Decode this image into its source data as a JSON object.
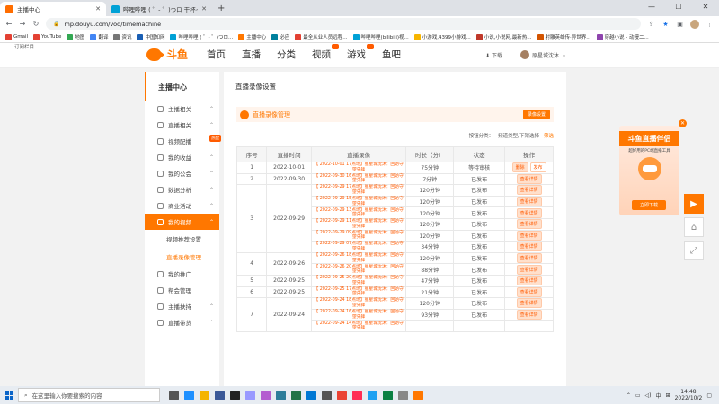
{
  "browser": {
    "tabs": [
      {
        "title": "主播中心",
        "active": true
      },
      {
        "title": "哔哩哔哩 ( ゜- ゜)つロ 干杯~-bili",
        "active": false
      }
    ],
    "new_tab": "+",
    "window_controls": [
      "—",
      "☐",
      "✕"
    ],
    "url": "mp.douyu.com/vod/timemachine",
    "bookmarks": [
      "Gmail",
      "YouTube",
      "地图",
      "翻译",
      "资讯",
      "中国知网",
      "哔哩哔哩 ( ゜- ゜)つロ...",
      "主播中心",
      "必应",
      "最全从业人员远程...",
      "哔哩哔哩(bilibili)视...",
      "小游戏,4399小游戏...",
      "小说,小说网,最新热...",
      "射雕英雄传·异世界...",
      "穿越小说 - 动漫二..."
    ]
  },
  "site": {
    "corner_text": "订阅栏目",
    "logo_text": "斗鱼",
    "nav": [
      "首页",
      "直播",
      "分类",
      "视频",
      "游戏",
      "鱼吧"
    ],
    "download_label": "下载",
    "username": "原星城沈沐"
  },
  "sidebar": {
    "title": "主播中心",
    "items": [
      {
        "label": "主播相关",
        "chevron": "⌃"
      },
      {
        "label": "直播相关",
        "chevron": "⌃"
      },
      {
        "label": "视频配播",
        "hot": "热配"
      },
      {
        "label": "我的收益",
        "chevron": "⌃"
      },
      {
        "label": "我的公会",
        "chevron": "⌃"
      },
      {
        "label": "数据分析",
        "chevron": "⌃"
      },
      {
        "label": "商业活动",
        "chevron": "⌃"
      },
      {
        "label": "我的视频",
        "chevron": "⌃",
        "active": true
      }
    ],
    "subitems": [
      "视频推荐设置",
      "直播录像管理"
    ],
    "bottom_items": [
      {
        "label": "我的推广"
      },
      {
        "label": "帮会管理"
      },
      {
        "label": "主播扶持",
        "chevron": "⌃"
      },
      {
        "label": "直播带货",
        "chevron": "⌃"
      }
    ]
  },
  "main": {
    "page_title": "直播录像设置",
    "section_title": "直播录像管理",
    "section_button": "录像设置",
    "filters": {
      "label": "按钮分类：",
      "value": "频道类型/下架选择",
      "link": "筛选"
    },
    "columns": [
      "序号",
      "直播时间",
      "直播录像",
      "时长（分）",
      "状态",
      "操作"
    ],
    "rows": [
      {
        "no": "1",
        "date": "2022-10-01",
        "span": 1,
        "videos": [
          {
            "title": "【 2022-10-01 17点场】星星城沈沐：回访守望先锋",
            "duration": "75分钟",
            "status": "等待审核",
            "action": "删除",
            "action2": "发布"
          }
        ]
      },
      {
        "no": "2",
        "date": "2022-09-30",
        "span": 1,
        "videos": [
          {
            "title": "【 2022-09-30 16点场】星星城沈沐：回访守望先锋",
            "duration": "7分钟",
            "status": "已发布",
            "action": "查看详情"
          }
        ]
      },
      {
        "no": "3",
        "date": "2022-09-29",
        "span": 6,
        "videos": [
          {
            "title": "【 2022-09-29 17点场】星星城沈沐：回访守望先锋",
            "duration": "120分钟",
            "status": "已发布",
            "action": "查看详情"
          },
          {
            "title": "【 2022-09-29 15点场】星星城沈沐：回访守望先锋",
            "duration": "120分钟",
            "status": "已发布",
            "action": "查看详情"
          },
          {
            "title": "【 2022-09-29 13点场】星星城沈沐：回访守望先锋",
            "duration": "120分钟",
            "status": "已发布",
            "action": "查看详情"
          },
          {
            "title": "【 2022-09-29 11点场】星星城沈沐：回访守望先锋",
            "duration": "120分钟",
            "status": "已发布",
            "action": "查看详情"
          },
          {
            "title": "【 2022-09-29 09点场】星星城沈沐：回访守望先锋",
            "duration": "120分钟",
            "status": "已发布",
            "action": "查看详情"
          },
          {
            "title": "【 2022-09-29 07点场】星星城沈沐：回访守望先锋",
            "duration": "34分钟",
            "status": "已发布",
            "action": "查看详情"
          }
        ]
      },
      {
        "no": "4",
        "date": "2022-09-26",
        "span": 2,
        "videos": [
          {
            "title": "【 2022-09-26 18点场】星星城沈沐：回访守望先锋",
            "duration": "120分钟",
            "status": "已发布",
            "action": "查看详情"
          },
          {
            "title": "【 2022-09-26 20点场】星星城沈沐：回访守望先锋",
            "duration": "88分钟",
            "status": "已发布",
            "action": "查看详情"
          }
        ]
      },
      {
        "no": "5",
        "date": "2022-09-25",
        "span": 1,
        "videos": [
          {
            "title": "【 2022-09-25 20点场】星星城沈沐：回访守望先锋",
            "duration": "47分钟",
            "status": "已发布",
            "action": "查看详情"
          }
        ]
      },
      {
        "no": "6",
        "date": "2022-09-25",
        "span": 1,
        "videos": [
          {
            "title": "【 2022-09-25 17点场】星星城沈沐：回访守望先锋",
            "duration": "21分钟",
            "status": "已发布",
            "action": "查看详情"
          }
        ]
      },
      {
        "no": "7",
        "date": "2022-09-24",
        "span": 3,
        "videos": [
          {
            "title": "【 2022-09-24 18点场】星星城沈沐：回访守望先锋",
            "duration": "120分钟",
            "status": "已发布",
            "action": "查看详情"
          },
          {
            "title": "【 2022-09-24 16点场】星星城沈沐：回访守望先锋",
            "duration": "93分钟",
            "status": "已发布",
            "action": "查看详情"
          },
          {
            "title": "【 2022-09-24 14点场】星星城沈沐：回访守望先锋",
            "duration": "",
            "status": "",
            "action": ""
          }
        ]
      }
    ]
  },
  "ad": {
    "title": "斗鱼直播伴侣",
    "subtitle": "超好用的PC端直播工具",
    "mascot_text": "DOUYU",
    "button": "立即下载",
    "close": "✕"
  },
  "taskbar": {
    "search_placeholder": "在这里输入你要搜索的内容",
    "tray_lang": "中",
    "time": "14:48",
    "date": "2022/10/2"
  },
  "colors": {
    "accent": "#ff7700",
    "link": "#ff5a00"
  }
}
